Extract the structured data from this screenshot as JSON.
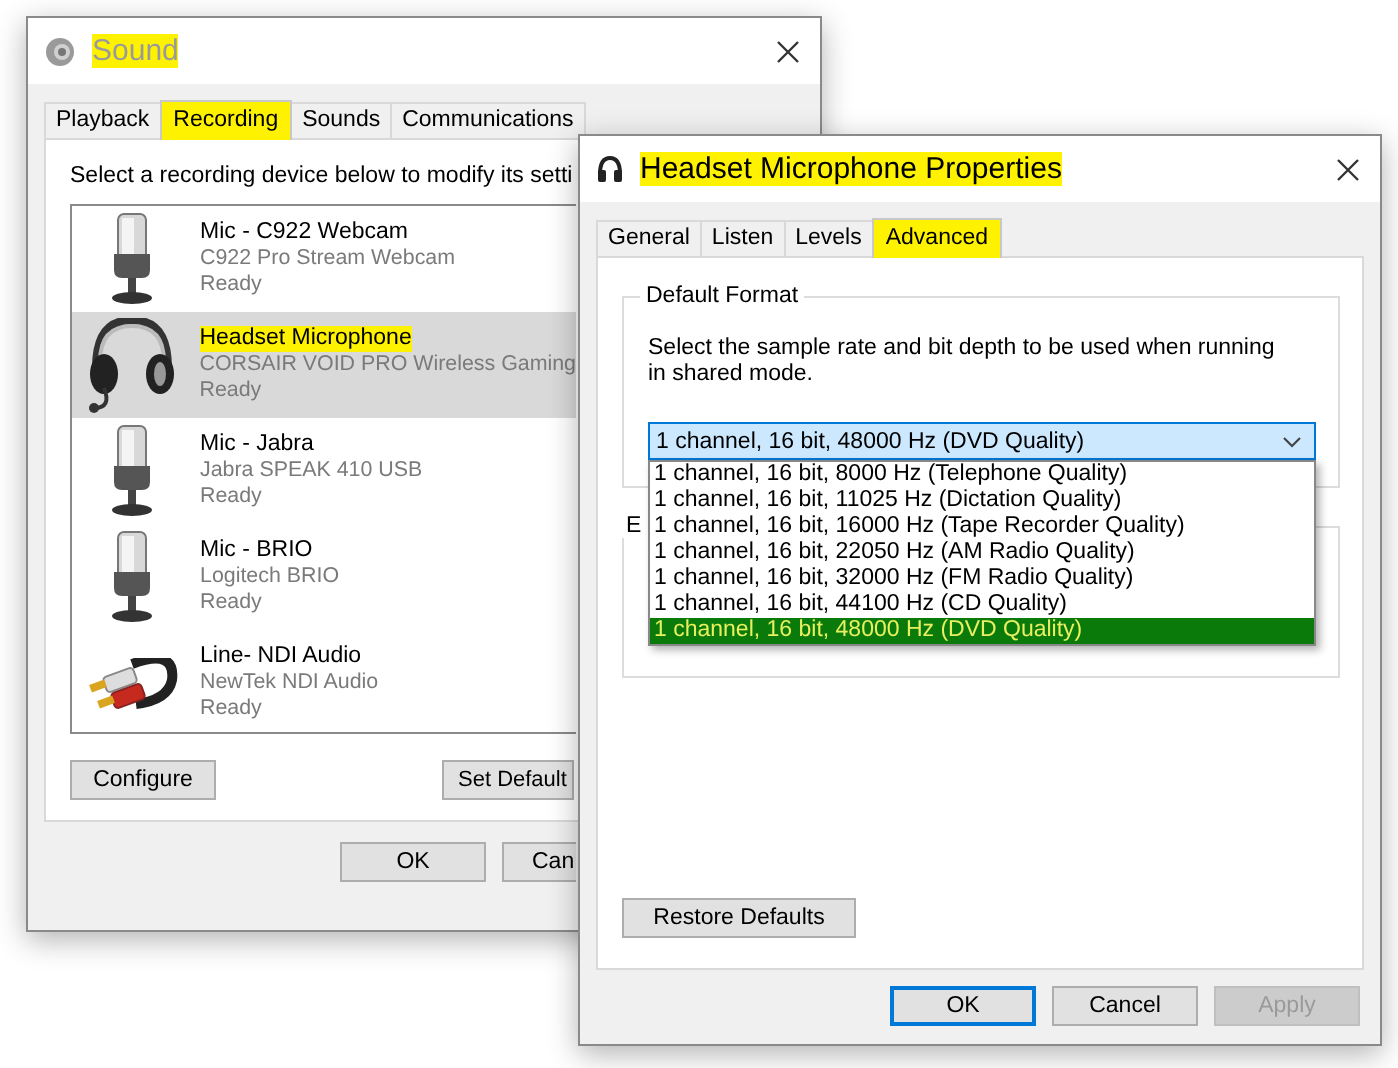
{
  "sound_window": {
    "title": {
      "text": "Sound",
      "highlighted": true
    },
    "tabs": [
      {
        "label": "Playback",
        "selected": false,
        "highlighted": false
      },
      {
        "label": "Recording",
        "selected": true,
        "highlighted": true
      },
      {
        "label": "Sounds",
        "selected": false,
        "highlighted": false
      },
      {
        "label": "Communications",
        "selected": false,
        "highlighted": false
      }
    ],
    "instruction": "Select a recording device below to modify its setti",
    "devices": [
      {
        "kind": "mic",
        "name": "Mic - C922 Webcam",
        "description": "C922 Pro Stream Webcam",
        "status": "Ready",
        "selected": false,
        "highlighted": false
      },
      {
        "kind": "headset",
        "name": "Headset Microphone",
        "description": "CORSAIR VOID PRO Wireless Gaming",
        "status": "Ready",
        "selected": true,
        "highlighted": true
      },
      {
        "kind": "mic",
        "name": "Mic - Jabra",
        "description": "Jabra SPEAK 410 USB",
        "status": "Ready",
        "selected": false,
        "highlighted": false
      },
      {
        "kind": "mic",
        "name": "Mic - BRIO",
        "description": "Logitech BRIO",
        "status": "Ready",
        "selected": false,
        "highlighted": false
      },
      {
        "kind": "cable",
        "name": "Line- NDI Audio",
        "description": "NewTek NDI Audio",
        "status": "Ready",
        "selected": false,
        "highlighted": false
      }
    ],
    "buttons": [
      "Configure",
      "Set Default"
    ],
    "footer_buttons": [
      "OK",
      "Can"
    ]
  },
  "properties_window": {
    "title": {
      "text": "Headset Microphone Properties",
      "highlighted": true
    },
    "tabs": [
      {
        "label": "General",
        "selected": false,
        "highlighted": false
      },
      {
        "label": "Listen",
        "selected": false,
        "highlighted": false
      },
      {
        "label": "Levels",
        "selected": false,
        "highlighted": false
      },
      {
        "label": "Advanced",
        "selected": true,
        "highlighted": true
      }
    ],
    "default_format": {
      "legend": "Default Format",
      "description": "Select the sample rate and bit depth to be used when running in shared mode.",
      "dropdown": {
        "value": "1 channel, 16 bit, 48000 Hz (DVD Quality)",
        "expanded": true,
        "options": [
          {
            "label": "1 channel, 16 bit, 8000 Hz (Telephone Quality)",
            "selected": false,
            "highlighted": false
          },
          {
            "label": "1 channel, 16 bit, 11025 Hz (Dictation Quality)",
            "selected": false,
            "highlighted": false
          },
          {
            "label": "1 channel, 16 bit, 16000 Hz (Tape Recorder Quality)",
            "selected": false,
            "highlighted": false
          },
          {
            "label": "1 channel, 16 bit, 22050 Hz (AM Radio Quality)",
            "selected": false,
            "highlighted": false
          },
          {
            "label": "1 channel, 16 bit, 32000 Hz (FM Radio Quality)",
            "selected": false,
            "highlighted": false
          },
          {
            "label": "1 channel, 16 bit, 44100 Hz (CD Quality)",
            "selected": false,
            "highlighted": false
          },
          {
            "label": "1 channel, 16 bit, 48000 Hz (DVD Quality)",
            "selected": true,
            "highlighted": true
          }
        ]
      }
    },
    "second_group": {
      "legend": "E"
    },
    "restore_button": "Restore Defaults",
    "footer_buttons": [
      {
        "label": "OK",
        "kind": "default"
      },
      {
        "label": "Cancel",
        "kind": "normal"
      },
      {
        "label": "Apply",
        "kind": "disabled"
      }
    ]
  }
}
